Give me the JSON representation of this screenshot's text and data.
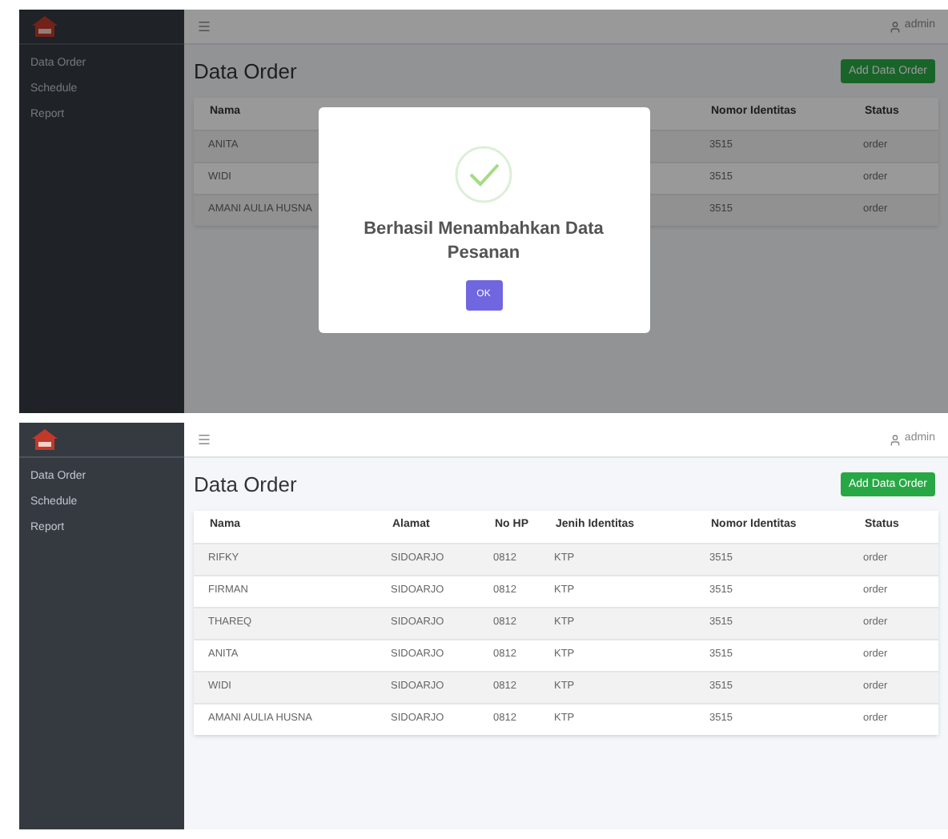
{
  "screens": [
    {
      "sidebar": {
        "items": [
          {
            "label": "Data Order"
          },
          {
            "label": "Schedule"
          },
          {
            "label": "Report"
          }
        ]
      },
      "user": "admin",
      "title": "Data Order",
      "add_button": "Add Data Order",
      "table": {
        "columns": [
          "Nama",
          "Nomor Identitas",
          "Status"
        ],
        "rows": [
          [
            "ANITA",
            "3515",
            "order"
          ],
          [
            "WIDI",
            "3515",
            "order"
          ],
          [
            "AMANI AULIA HUSNA",
            "3515",
            "order"
          ]
        ]
      },
      "dialog": {
        "message": "Berhasil Menambahkan Data Pesanan",
        "button": "OK"
      }
    },
    {
      "sidebar": {
        "items": [
          {
            "label": "Data Order"
          },
          {
            "label": "Schedule"
          },
          {
            "label": "Report"
          }
        ]
      },
      "user": "admin",
      "title": "Data Order",
      "add_button": "Add Data Order",
      "table": {
        "columns": [
          "Nama",
          "Alamat",
          "No HP",
          "Jenih Identitas",
          "Nomor Identitas",
          "Status"
        ],
        "rows": [
          [
            "RIFKY",
            "SIDOARJO",
            "0812",
            "KTP",
            "3515",
            "order"
          ],
          [
            "FIRMAN",
            "SIDOARJO",
            "0812",
            "KTP",
            "3515",
            "order"
          ],
          [
            "THAREQ",
            "SIDOARJO",
            "0812",
            "KTP",
            "3515",
            "order"
          ],
          [
            "ANITA",
            "SIDOARJO",
            "0812",
            "KTP",
            "3515",
            "order"
          ],
          [
            "WIDI",
            "SIDOARJO",
            "0812",
            "KTP",
            "3515",
            "order"
          ],
          [
            "AMANI AULIA HUSNA",
            "SIDOARJO",
            "0812",
            "KTP",
            "3515",
            "order"
          ]
        ]
      }
    }
  ]
}
